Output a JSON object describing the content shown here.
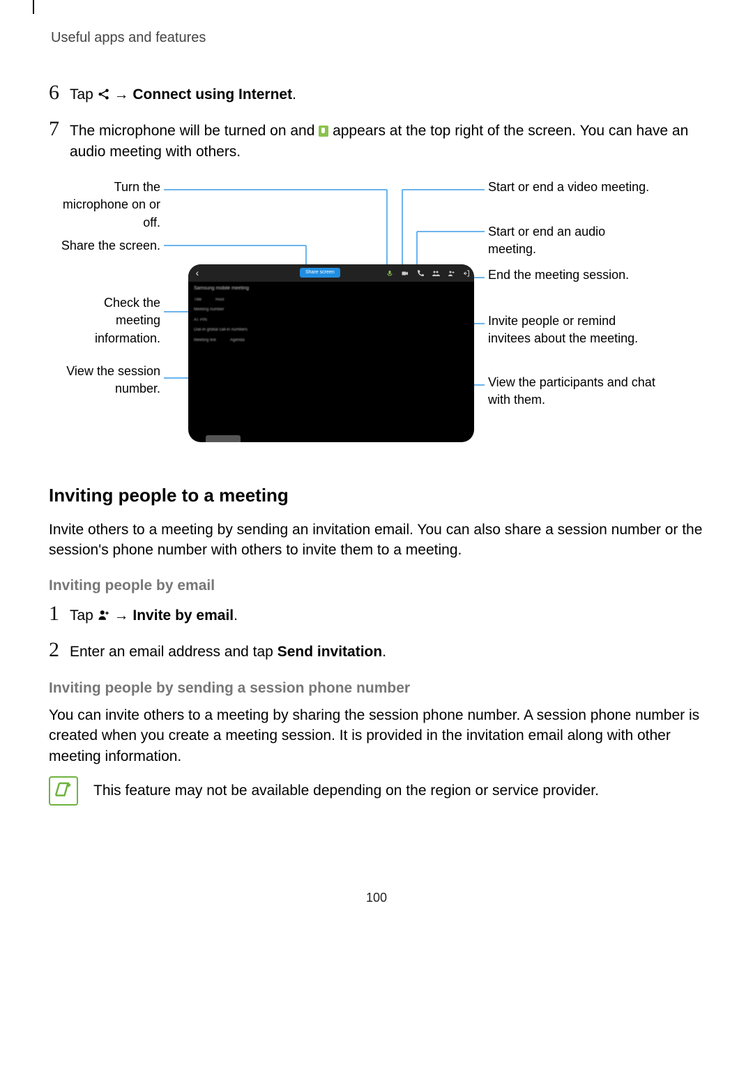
{
  "header": "Useful apps and features",
  "step6": {
    "num": "6",
    "pre": "Tap ",
    "arrow": " → ",
    "cmd": "Connect using Internet",
    "end": "."
  },
  "step7": {
    "num": "7",
    "pre": "The microphone will be turned on and ",
    "post": " appears at the top right of the screen. You can have an audio meeting with others."
  },
  "diagram": {
    "left": {
      "mic": "Turn the microphone on or off.",
      "share": "Share the screen.",
      "info": "Check the meeting information.",
      "session": "View the session number."
    },
    "right": {
      "video": "Start or end a video meeting.",
      "audio": "Start or end an audio meeting.",
      "end": "End the meeting session.",
      "invite": "Invite people or remind invitees about the meeting.",
      "chat": "View the participants and chat with them."
    },
    "panel": {
      "title": "Samsung mobile meeting",
      "r1a": "Title",
      "r1b": "Host",
      "r2a": "Meeting number",
      "r3a": "AT PIN",
      "r4a": "Dial-in global call-in numbers",
      "r5a": "Meeting link",
      "r5b": "Agenda"
    },
    "sharePill": "Share screen"
  },
  "section": {
    "title": "Inviting people to a meeting",
    "body": "Invite others to a meeting by sending an invitation email. You can also share a session number or the session's phone number with others to invite them to a meeting."
  },
  "email": {
    "title": "Inviting people by email",
    "s1num": "1",
    "s1pre": "Tap ",
    "s1arrow": " → ",
    "s1cmd": "Invite by email",
    "s1end": ".",
    "s2num": "2",
    "s2pre": "Enter an email address and tap ",
    "s2cmd": "Send invitation",
    "s2end": "."
  },
  "phone": {
    "title": "Inviting people by sending a session phone number",
    "body": "You can invite others to a meeting by sharing the session phone number. A session phone number is created when you create a meeting session. It is provided in the invitation email along with other meeting information."
  },
  "note": "This feature may not be available depending on the region or service provider.",
  "pageNum": "100"
}
